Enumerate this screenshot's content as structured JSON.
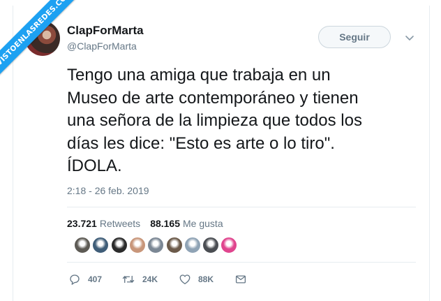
{
  "watermark": {
    "text": "VISTOENLASREDES.COM"
  },
  "user": {
    "display_name": "ClapForMarta",
    "handle": "@ClapForMarta",
    "follow_label": "Seguir"
  },
  "tweet": {
    "lines": [
      "Tengo una amiga que trabaja en un",
      "Museo de arte contemporáneo y tienen",
      "una señora de la limpieza que todos los",
      "días les dice: \"Esto es arte o lo tiro\".",
      "ÍDOLA."
    ],
    "timestamp": "2:18 - 26 feb. 2019"
  },
  "stats": {
    "retweets_count": "23.721",
    "retweets_label": "Retweets",
    "likes_count": "88.165",
    "likes_label": "Me gusta"
  },
  "likers": [
    "#5d5a54",
    "#3f5d78",
    "#2b2b2b",
    "#c8967a",
    "#7b8794",
    "#6b5a4a",
    "#8fa3b5",
    "#4a4d52",
    "#e0458e"
  ],
  "actions": {
    "replies": "407",
    "retweets": "24K",
    "likes": "88K"
  },
  "colors": {
    "accent": "#1da1f2",
    "text": "#14171a",
    "secondary": "#657786"
  }
}
